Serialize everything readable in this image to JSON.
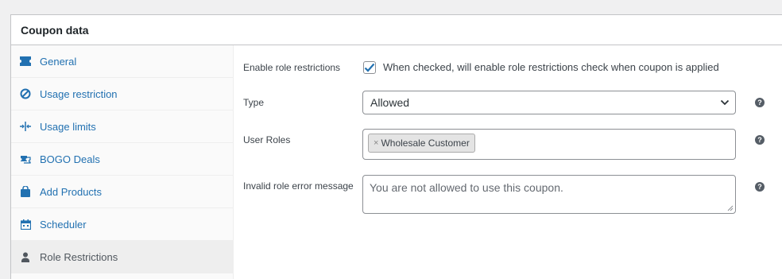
{
  "panel": {
    "title": "Coupon data"
  },
  "tabs": [
    {
      "label": "General",
      "icon": "ticket-icon",
      "active": false
    },
    {
      "label": "Usage restriction",
      "icon": "block-icon",
      "active": false
    },
    {
      "label": "Usage limits",
      "icon": "limits-icon",
      "active": false
    },
    {
      "label": "BOGO Deals",
      "icon": "bogo-icon",
      "active": false
    },
    {
      "label": "Add Products",
      "icon": "bag-icon",
      "active": false
    },
    {
      "label": "Scheduler",
      "icon": "calendar-icon",
      "active": false
    },
    {
      "label": "Role Restrictions",
      "icon": "user-icon",
      "active": true
    }
  ],
  "fields": {
    "enable": {
      "label": "Enable role restrictions",
      "checked": true,
      "description": "When checked, will enable role restrictions check when coupon is applied"
    },
    "type": {
      "label": "Type",
      "value": "Allowed"
    },
    "roles": {
      "label": "User Roles",
      "chips": [
        "Wholesale Customer"
      ],
      "remove_glyph": "×"
    },
    "error": {
      "label": "Invalid role error message",
      "placeholder": "You are not allowed to use this coupon."
    }
  },
  "help_glyph": "?",
  "colors": {
    "link": "#2271b1",
    "active_tab_bg": "#eeeeee",
    "checkmark": "#2271b1"
  }
}
